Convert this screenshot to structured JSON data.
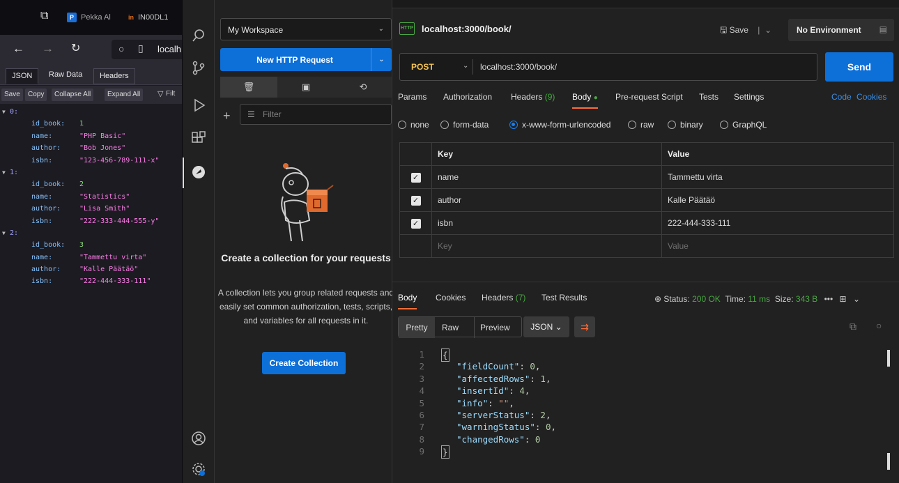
{
  "browser": {
    "tabs": [
      {
        "label": "Pekka Al",
        "favicon": "P",
        "color": "#1a6fd6"
      },
      {
        "label": "IN00DL1",
        "favicon": "in",
        "color": "#e0701d"
      }
    ],
    "url": "localh",
    "json_tabs": [
      "JSON",
      "Raw Data",
      "Headers"
    ],
    "toolbar": [
      "Save",
      "Copy",
      "Collapse All",
      "Expand All",
      "Filt"
    ],
    "items": [
      {
        "index": "0:",
        "id_book": "1",
        "name": "\"PHP Basic\"",
        "author": "\"Bob Jones\"",
        "isbn": "\"123-456-789-111-x\""
      },
      {
        "index": "1:",
        "id_book": "2",
        "name": "\"Statistics\"",
        "author": "\"Lisa Smith\"",
        "isbn": "\"222-333-444-555-y\""
      },
      {
        "index": "2:",
        "id_book": "3",
        "name": "\"Tammettu virta\"",
        "author": "\"Kalle Päätäö\"",
        "isbn": "\"222-444-333-111\""
      }
    ],
    "keys": {
      "id_book": "id_book:",
      "name": "name:",
      "author": "author:",
      "isbn": "isbn:"
    }
  },
  "collections": {
    "workspace": "My Workspace",
    "new_request": "New HTTP Request",
    "filter_placeholder": "Filter",
    "empty_title": "Create a collection for your requests",
    "empty_desc": "A collection lets you group related requests and easily set common authorization, tests, scripts, and variables for all requests in it.",
    "create_button": "Create Collection"
  },
  "request": {
    "title": "localhost:3000/book/",
    "save": "Save",
    "environment": "No Environment",
    "method": "POST",
    "url": "localhost:3000/book/",
    "send": "Send",
    "tabs": {
      "params": "Params",
      "authorization": "Authorization",
      "headers": "Headers",
      "headers_count": "(9)",
      "body": "Body",
      "prerequest": "Pre-request Script",
      "tests": "Tests",
      "settings": "Settings",
      "code": "Code",
      "cookies": "Cookies"
    },
    "body_types": [
      "none",
      "form-data",
      "x-www-form-urlencoded",
      "raw",
      "binary",
      "GraphQL"
    ],
    "selected_body_type": "x-www-form-urlencoded",
    "table": {
      "key_header": "Key",
      "value_header": "Value",
      "rows": [
        {
          "key": "name",
          "value": "Tammettu virta",
          "checked": true
        },
        {
          "key": "author",
          "value": "Kalle Päätäö",
          "checked": true
        },
        {
          "key": "isbn",
          "value": "222-444-333-111",
          "checked": true
        }
      ],
      "key_placeholder": "Key",
      "value_placeholder": "Value"
    }
  },
  "response": {
    "tabs": {
      "body": "Body",
      "cookies": "Cookies",
      "headers": "Headers",
      "headers_count": "(7)",
      "tests": "Test Results"
    },
    "status_label": "Status:",
    "status": "200 OK",
    "time_label": "Time:",
    "time": "11 ms",
    "size_label": "Size:",
    "size": "343 B",
    "formats": [
      "Pretty",
      "Raw",
      "Preview"
    ],
    "lang": "JSON",
    "lines": [
      "1",
      "2",
      "3",
      "4",
      "5",
      "6",
      "7",
      "8",
      "9"
    ],
    "json": [
      {
        "key": "\"fieldCount\"",
        "value": "0",
        "type": "n"
      },
      {
        "key": "\"affectedRows\"",
        "value": "1",
        "type": "n"
      },
      {
        "key": "\"insertId\"",
        "value": "4",
        "type": "n"
      },
      {
        "key": "\"info\"",
        "value": "\"\"",
        "type": "s"
      },
      {
        "key": "\"serverStatus\"",
        "value": "2",
        "type": "n"
      },
      {
        "key": "\"warningStatus\"",
        "value": "0",
        "type": "n"
      },
      {
        "key": "\"changedRows\"",
        "value": "0",
        "type": "n"
      }
    ]
  },
  "colors": {
    "accent": "#0d6fd8",
    "method": "#f5c451",
    "ok": "#49a843",
    "active_tab": "#ff6c37"
  }
}
